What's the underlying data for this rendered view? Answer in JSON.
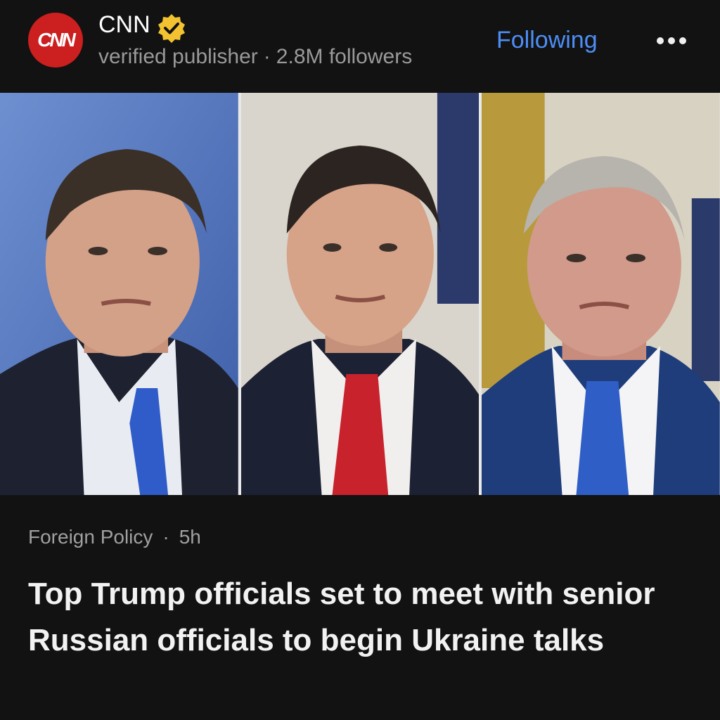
{
  "publisher": {
    "logo_text": "CNN",
    "name": "CNN",
    "verified_badge_icon": "verified-check-icon",
    "subtitle": "verified publisher",
    "separator": "·",
    "followers": "2.8M followers",
    "follow_label": "Following",
    "more_icon": "more-options-icon"
  },
  "article": {
    "category": "Foreign Policy",
    "separator": "·",
    "age": "5h",
    "headline": "Top Trump officials set to meet with senior Russian officials to begin Ukraine talks"
  },
  "colors": {
    "background": "#121212",
    "accent_link": "#4d8ef7",
    "brand_red": "#cc1f1f",
    "verified_gold": "#f2c230",
    "muted_text": "#9a9a9a"
  }
}
